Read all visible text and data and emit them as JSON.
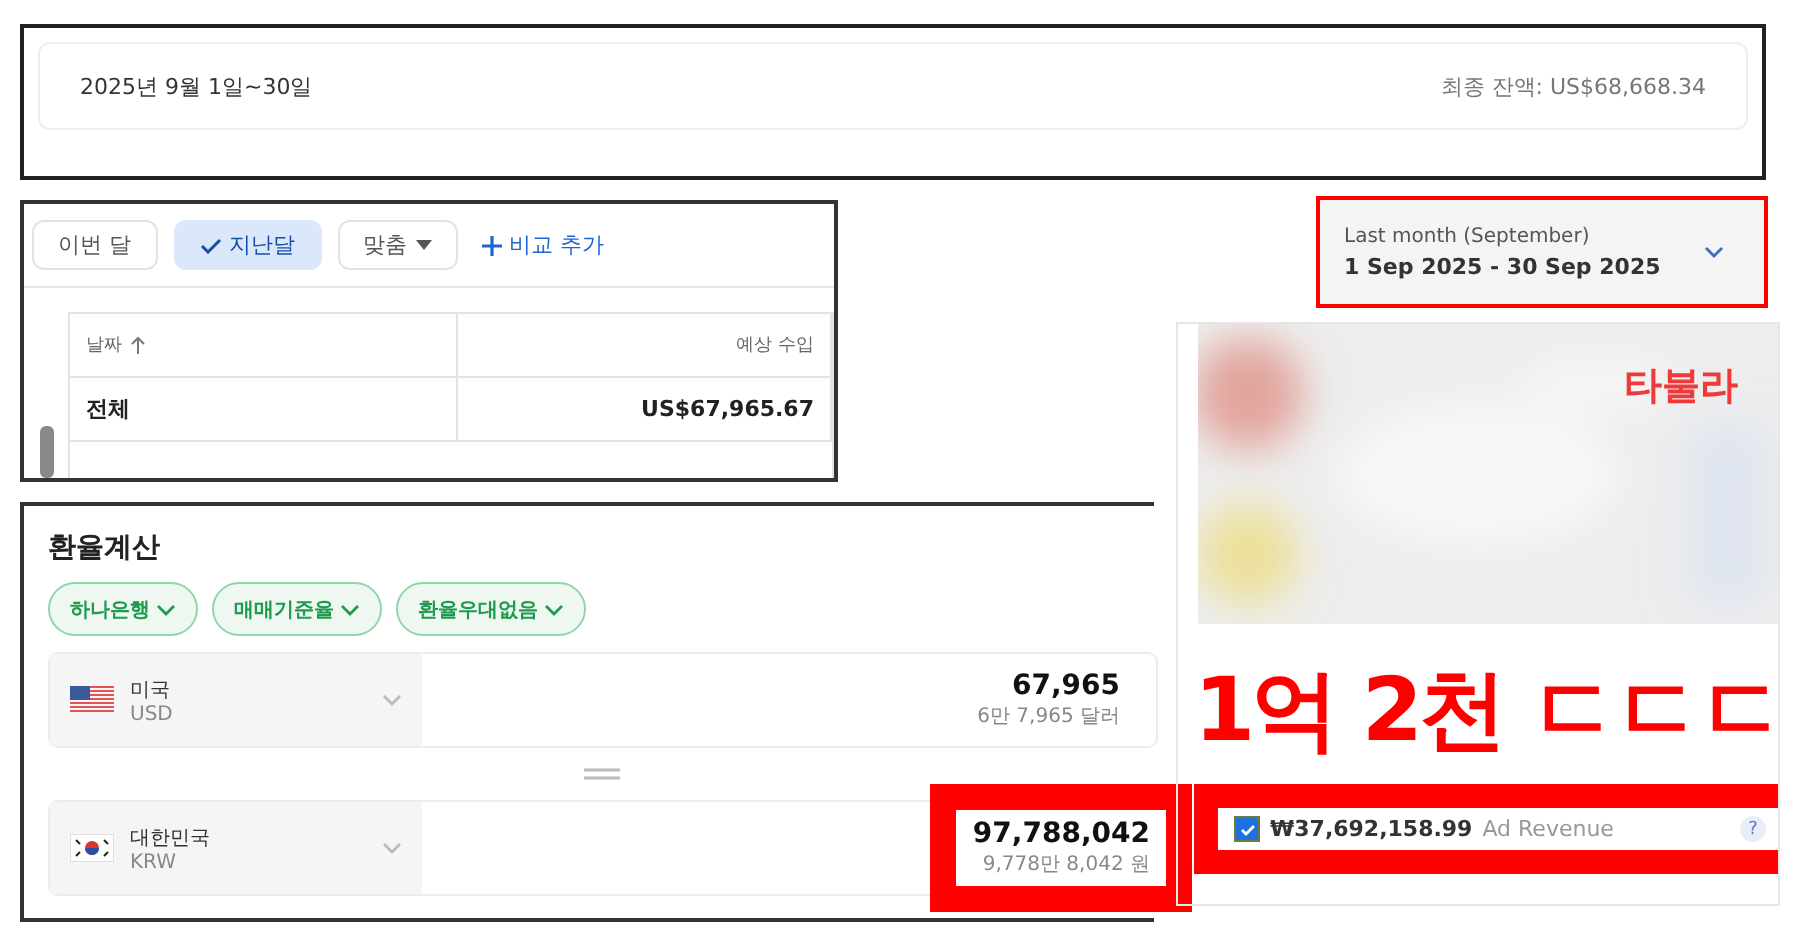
{
  "summary": {
    "date_range": "2025년 9월 1일~30일",
    "final_balance": "최종 잔액: US$68,668.34"
  },
  "report": {
    "presets": [
      {
        "label": "이번 달",
        "selected": false
      },
      {
        "label": "지난달",
        "selected": true
      }
    ],
    "custom": "맞춤",
    "add_compare": "비교 추가",
    "columns": [
      "날짜",
      "예상 수입"
    ],
    "rows": [
      [
        "전체",
        "US$67,965.67"
      ]
    ]
  },
  "exchange": {
    "title": "환율계산",
    "filters": [
      "하나은행",
      "매매기준율",
      "환율우대없음"
    ],
    "currencies": [
      {
        "country": "미국",
        "code": "USD",
        "kind": "us",
        "amount": "67,965",
        "amount_words": "6만 7,965 달러",
        "highlighted": false
      },
      {
        "country": "대한민국",
        "code": "KRW",
        "kind": "kr",
        "amount": "97,788,042",
        "amount_words": "9,778만 8,042 원",
        "highlighted": true
      }
    ]
  },
  "date_picker": {
    "label": "Last month (September)",
    "range": "1 Sep 2025 - 30 Sep 2025"
  },
  "network_panel": {
    "name": "타불라",
    "revenue": {
      "checked": true,
      "amount": "₩37,692,158.99",
      "label": "Ad Revenue",
      "help": "?"
    }
  },
  "caption": "1억 2천 ㄷㄷㄷ"
}
